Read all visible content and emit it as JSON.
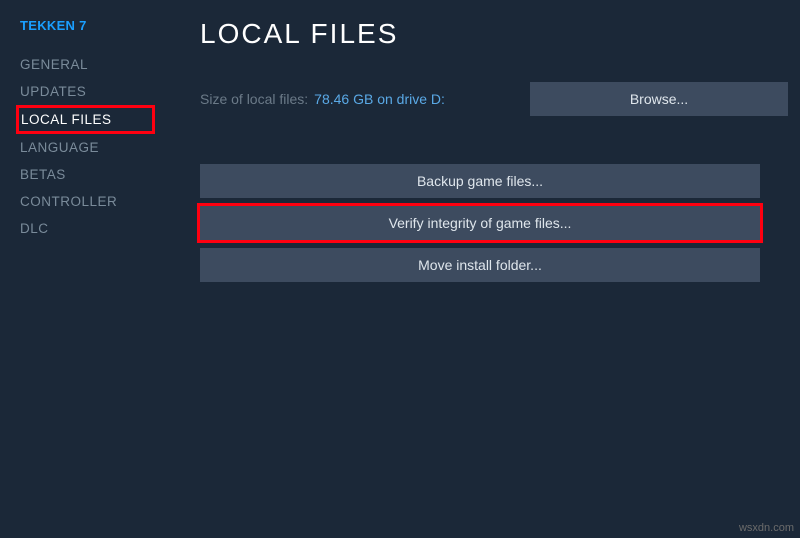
{
  "game_title": "TEKKEN 7",
  "sidebar": {
    "items": [
      {
        "label": "GENERAL"
      },
      {
        "label": "UPDATES"
      },
      {
        "label": "LOCAL FILES"
      },
      {
        "label": "LANGUAGE"
      },
      {
        "label": "BETAS"
      },
      {
        "label": "CONTROLLER"
      },
      {
        "label": "DLC"
      }
    ],
    "active_index": 2
  },
  "main": {
    "title": "LOCAL FILES",
    "size_label": "Size of local files:",
    "size_value": "78.46 GB on drive D:",
    "browse_label": "Browse...",
    "buttons": {
      "backup": "Backup game files...",
      "verify": "Verify integrity of game files...",
      "move": "Move install folder..."
    }
  },
  "watermark": "wsxdn.com"
}
